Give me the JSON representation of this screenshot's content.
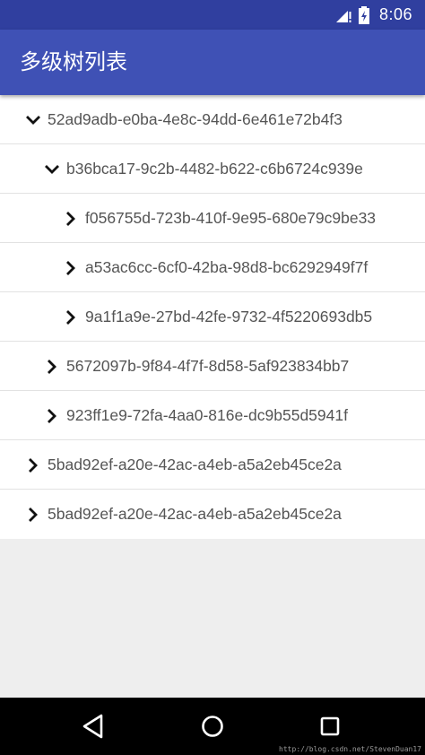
{
  "status_bar": {
    "time": "8:06",
    "icons": [
      "signal-icon",
      "battery-icon"
    ],
    "color": "#303f9f"
  },
  "app_bar": {
    "title": "多级树列表",
    "color": "#3f51b5"
  },
  "tree": {
    "rows": [
      {
        "label": "52ad9adb-e0ba-4e8c-94dd-6e461e72b4f3",
        "level": 0,
        "expanded": true
      },
      {
        "label": "b36bca17-9c2b-4482-b622-c6b6724c939e",
        "level": 1,
        "expanded": true
      },
      {
        "label": "f056755d-723b-410f-9e95-680e79c9be33",
        "level": 2,
        "expanded": false
      },
      {
        "label": "a53ac6cc-6cf0-42ba-98d8-bc6292949f7f",
        "level": 2,
        "expanded": false
      },
      {
        "label": "9a1f1a9e-27bd-42fe-9732-4f5220693db5",
        "level": 2,
        "expanded": false
      },
      {
        "label": "5672097b-9f84-4f7f-8d58-5af923834bb7",
        "level": 1,
        "expanded": false
      },
      {
        "label": "923ff1e9-72fa-4aa0-816e-dc9b55d5941f",
        "level": 1,
        "expanded": false
      },
      {
        "label": "5bad92ef-a20e-42ac-a4eb-a5a2eb45ce2a",
        "level": 0,
        "expanded": false
      },
      {
        "label": "5bad92ef-a20e-42ac-a4eb-a5a2eb45ce2a",
        "level": 0,
        "expanded": false
      }
    ]
  },
  "nav_bar": {
    "buttons": [
      "back-icon",
      "home-icon",
      "recents-icon"
    ]
  },
  "watermark": "http://blog.csdn.net/StevenDuan17"
}
